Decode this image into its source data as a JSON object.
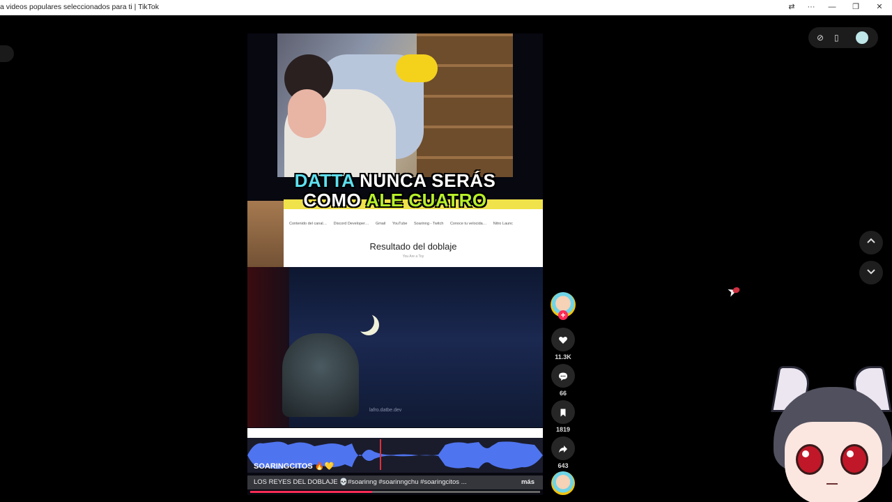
{
  "window": {
    "title": "a videos populares seleccionados para ti | TikTok",
    "controls": {
      "translate": "⇄",
      "more": "···",
      "minimize": "—",
      "restore": "❐",
      "close": "✕"
    }
  },
  "video": {
    "caption_line1": {
      "part1": "DATTA",
      "part2": " NUNCA SERÁS"
    },
    "caption_line2": {
      "part1": "COMO ",
      "part2": "ALE CUATRO"
    },
    "browser": {
      "bookmarks": [
        "Contenido del canal…",
        "Discord Developer…",
        "Gmail",
        "YouTube",
        "Soarinng - Twitch",
        "Conoce tu velocida…",
        "Nitro Launc"
      ],
      "result_title": "Resultado del doblaje",
      "result_subtitle": "You Are a Toy"
    },
    "watermark": "lafro.datbe.dev",
    "author": "SOARINGCITOS",
    "author_emoji": "🔥💛",
    "description": "LOS REYES DEL DOBLAJE 💀#soarinng #soarinngchu #soaringcitos ...",
    "more_label": "más",
    "progress": 0.42
  },
  "actions": {
    "likes": "11.3K",
    "comments": "66",
    "saves": "1819",
    "shares": "643"
  },
  "colors": {
    "accent": "#fe2c55",
    "wave": "#4f74f0",
    "caption_cyan": "#5ee0f0",
    "caption_lime": "#b8f02a"
  }
}
